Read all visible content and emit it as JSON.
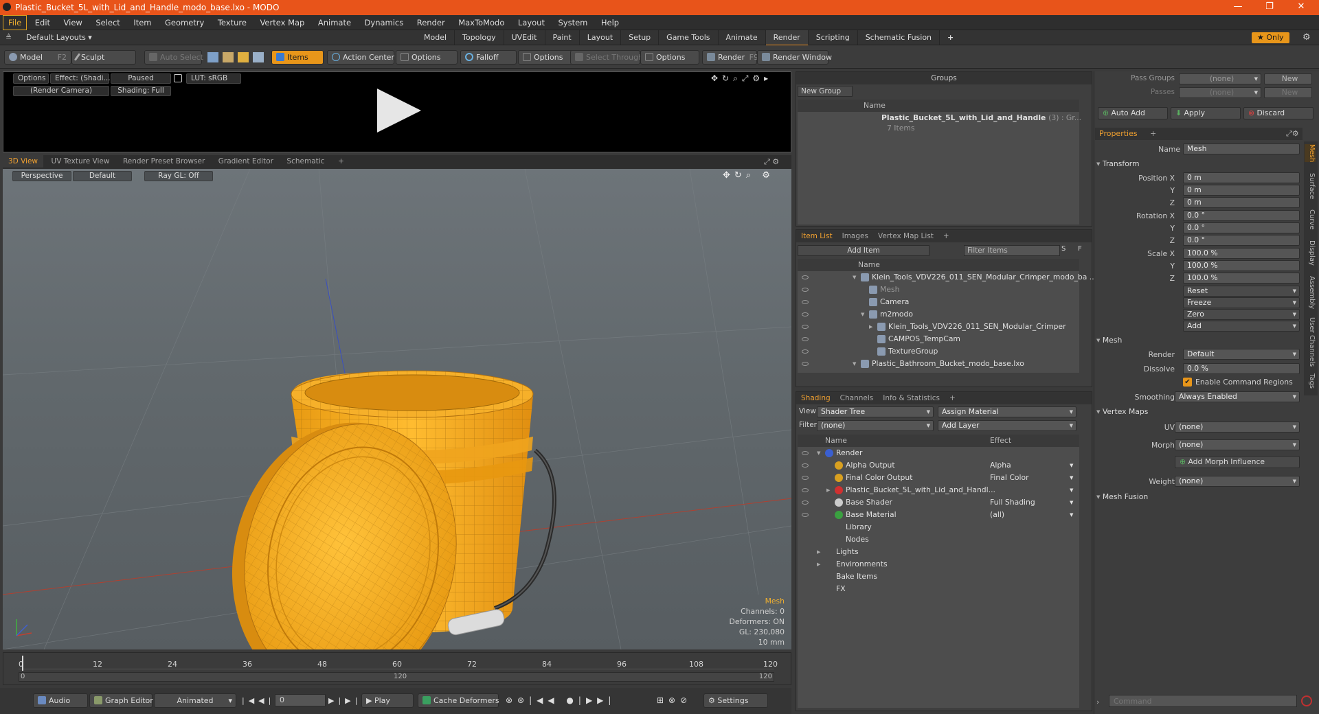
{
  "window": {
    "title": "Plastic_Bucket_5L_with_Lid_and_Handle_modo_base.lxo - MODO",
    "min": "—",
    "max": "❐",
    "close": "✕"
  },
  "menu": [
    "File",
    "Edit",
    "View",
    "Select",
    "Item",
    "Geometry",
    "Texture",
    "Vertex Map",
    "Animate",
    "Dynamics",
    "Render",
    "MaxToModo",
    "Layout",
    "System",
    "Help"
  ],
  "layouts": {
    "default_label": "Default Layouts ▾",
    "tabs": [
      "Model",
      "Topology",
      "UVEdit",
      "Paint",
      "Layout",
      "Setup",
      "Game Tools",
      "Animate",
      "Render",
      "Scripting",
      "Schematic Fusion"
    ],
    "active": "Render",
    "add": "+",
    "only": "★ Only"
  },
  "toolbar": {
    "model": "Model",
    "model_key": "F2",
    "sculpt": "Sculpt",
    "auto_select": "Auto Select",
    "items": "Items",
    "action_center": "Action Center",
    "options1": "Options",
    "falloff": "Falloff",
    "options2": "Options",
    "select_through": "Select Through",
    "options3": "Options",
    "render": "Render",
    "render_key": "F9",
    "render_window": "Render Window"
  },
  "preview": {
    "options": "Options",
    "effect": "Effect: (Shadi...",
    "paused": "Paused",
    "lut": "LUT: sRGB",
    "camera": "(Render Camera)",
    "shading": "Shading: Full"
  },
  "viewport_tabs": [
    "3D View",
    "UV Texture View",
    "Render Preset Browser",
    "Gradient Editor",
    "Schematic",
    "+"
  ],
  "viewport": {
    "perspective": "Perspective",
    "default": "Default",
    "raygl": "Ray GL: Off",
    "info": {
      "label": "Mesh",
      "channels": "Channels: 0",
      "deformers": "Deformers: ON",
      "gl": "GL: 230,080",
      "scale": "10 mm"
    }
  },
  "timeline": {
    "ticks": [
      "0",
      "12",
      "24",
      "36",
      "48",
      "60",
      "72",
      "84",
      "96",
      "108",
      "120"
    ],
    "sub_ticks": [
      "0",
      "120",
      "120"
    ]
  },
  "bottombar": {
    "audio": "Audio",
    "graph_editor": "Graph Editor",
    "animated": "Animated",
    "frame": "0",
    "play": "Play",
    "cache": "Cache Deformers",
    "settings": "Settings"
  },
  "groups": {
    "title": "Groups",
    "new_group": "New Group",
    "name_col": "Name",
    "item": "Plastic_Bucket_5L_with_Lid_and_Handle",
    "item_count": "(3) : Gr...",
    "items": "7 Items"
  },
  "item_list": {
    "tabs": [
      "Item List",
      "Images",
      "Vertex Map List",
      "+"
    ],
    "add_item": "Add Item",
    "filter": "Filter Items",
    "s": "S",
    "f": "F",
    "name_col": "Name",
    "rows": [
      {
        "text": "Klein_Tools_VDV226_011_SEN_Modular_Crimper_modo_ba ...",
        "indent": 0,
        "arrow": "▾"
      },
      {
        "text": "Mesh",
        "indent": 1,
        "arrow": "",
        "dim": true
      },
      {
        "text": "Camera",
        "indent": 1,
        "arrow": ""
      },
      {
        "text": "m2modo",
        "indent": 1,
        "arrow": "▾"
      },
      {
        "text": "Klein_Tools_VDV226_011_SEN_Modular_Crimper",
        "indent": 2,
        "arrow": "▸"
      },
      {
        "text": "CAMPOS_TempCam",
        "indent": 2,
        "arrow": ""
      },
      {
        "text": "TextureGroup",
        "indent": 2,
        "arrow": ""
      },
      {
        "text": "Plastic_Bathroom_Bucket_modo_base.lxo",
        "indent": 0,
        "arrow": "▾"
      }
    ]
  },
  "shading": {
    "tabs": [
      "Shading",
      "Channels",
      "Info & Statistics",
      "+"
    ],
    "view_label": "View",
    "view_value": "Shader Tree",
    "assign": "Assign Material",
    "filter_label": "Filter",
    "filter_value": "(none)",
    "add_layer": "Add Layer",
    "name_col": "Name",
    "effect_col": "Effect",
    "rows": [
      {
        "name": "Render",
        "effect": "",
        "indent": 0,
        "arrow": "▾",
        "color": "#3a5fd0"
      },
      {
        "name": "Alpha Output",
        "effect": "Alpha",
        "indent": 1,
        "arrow": "",
        "color": "#d9a020"
      },
      {
        "name": "Final Color Output",
        "effect": "Final Color",
        "indent": 1,
        "arrow": "",
        "color": "#d9a020"
      },
      {
        "name": "Plastic_Bucket_5L_with_Lid_and_Handl...",
        "effect": "",
        "indent": 1,
        "arrow": "▸",
        "color": "#d03030"
      },
      {
        "name": "Base Shader",
        "effect": "Full Shading",
        "indent": 1,
        "arrow": "",
        "color": "#cccccc"
      },
      {
        "name": "Base Material",
        "effect": "(all)",
        "indent": 1,
        "arrow": "",
        "color": "#3aa040"
      },
      {
        "name": "Library",
        "effect": "",
        "indent": 1,
        "arrow": "",
        "color": ""
      },
      {
        "name": "Nodes",
        "effect": "",
        "indent": 1,
        "arrow": "",
        "color": ""
      },
      {
        "name": "Lights",
        "effect": "",
        "indent": 0,
        "arrow": "▸",
        "color": ""
      },
      {
        "name": "Environments",
        "effect": "",
        "indent": 0,
        "arrow": "▸",
        "color": ""
      },
      {
        "name": "Bake Items",
        "effect": "",
        "indent": 0,
        "arrow": "",
        "color": ""
      },
      {
        "name": "FX",
        "effect": "",
        "indent": 0,
        "arrow": "",
        "color": ""
      }
    ]
  },
  "passes": {
    "pass_groups": "Pass Groups",
    "passes": "Passes",
    "none": "(none)",
    "new": "New",
    "auto_add": "Auto Add",
    "apply": "Apply",
    "discard": "Discard"
  },
  "properties": {
    "tab": "Properties",
    "add": "+",
    "name_label": "Name",
    "name_value": "Mesh",
    "transform": "Transform",
    "pos_label": "Position X",
    "rot_label": "Rotation X",
    "scale_label": "Scale X",
    "y": "Y",
    "z": "Z",
    "pos": [
      "0 m",
      "0 m",
      "0 m"
    ],
    "rot": [
      "0.0 °",
      "0.0 °",
      "0.0 °"
    ],
    "scale": [
      "100.0 %",
      "100.0 %",
      "100.0 %"
    ],
    "reset": "Reset",
    "freeze": "Freeze",
    "zero": "Zero",
    "addb": "Add",
    "mesh": "Mesh",
    "render_label": "Render",
    "render_value": "Default",
    "dissolve_label": "Dissolve",
    "dissolve_value": "0.0 %",
    "enable_cmd": "Enable Command Regions",
    "smoothing_label": "Smoothing",
    "smoothing_value": "Always Enabled",
    "vertex_maps": "Vertex Maps",
    "uv_label": "UV",
    "uv_value": "(none)",
    "morph_label": "Morph",
    "morph_value": "(none)",
    "add_morph": "Add Morph Influence",
    "weight_label": "Weight",
    "weight_value": "(none)",
    "mesh_fusion": "Mesh Fusion",
    "side_tabs": [
      "Mesh",
      "Surface",
      "Curve",
      "Display",
      "Assembly",
      "User Channels",
      "Tags"
    ]
  },
  "command": {
    "placeholder": "Command"
  },
  "colors": {
    "accent": "#e8961a",
    "title": "#e8541a",
    "bucket": "#f2a81c"
  }
}
